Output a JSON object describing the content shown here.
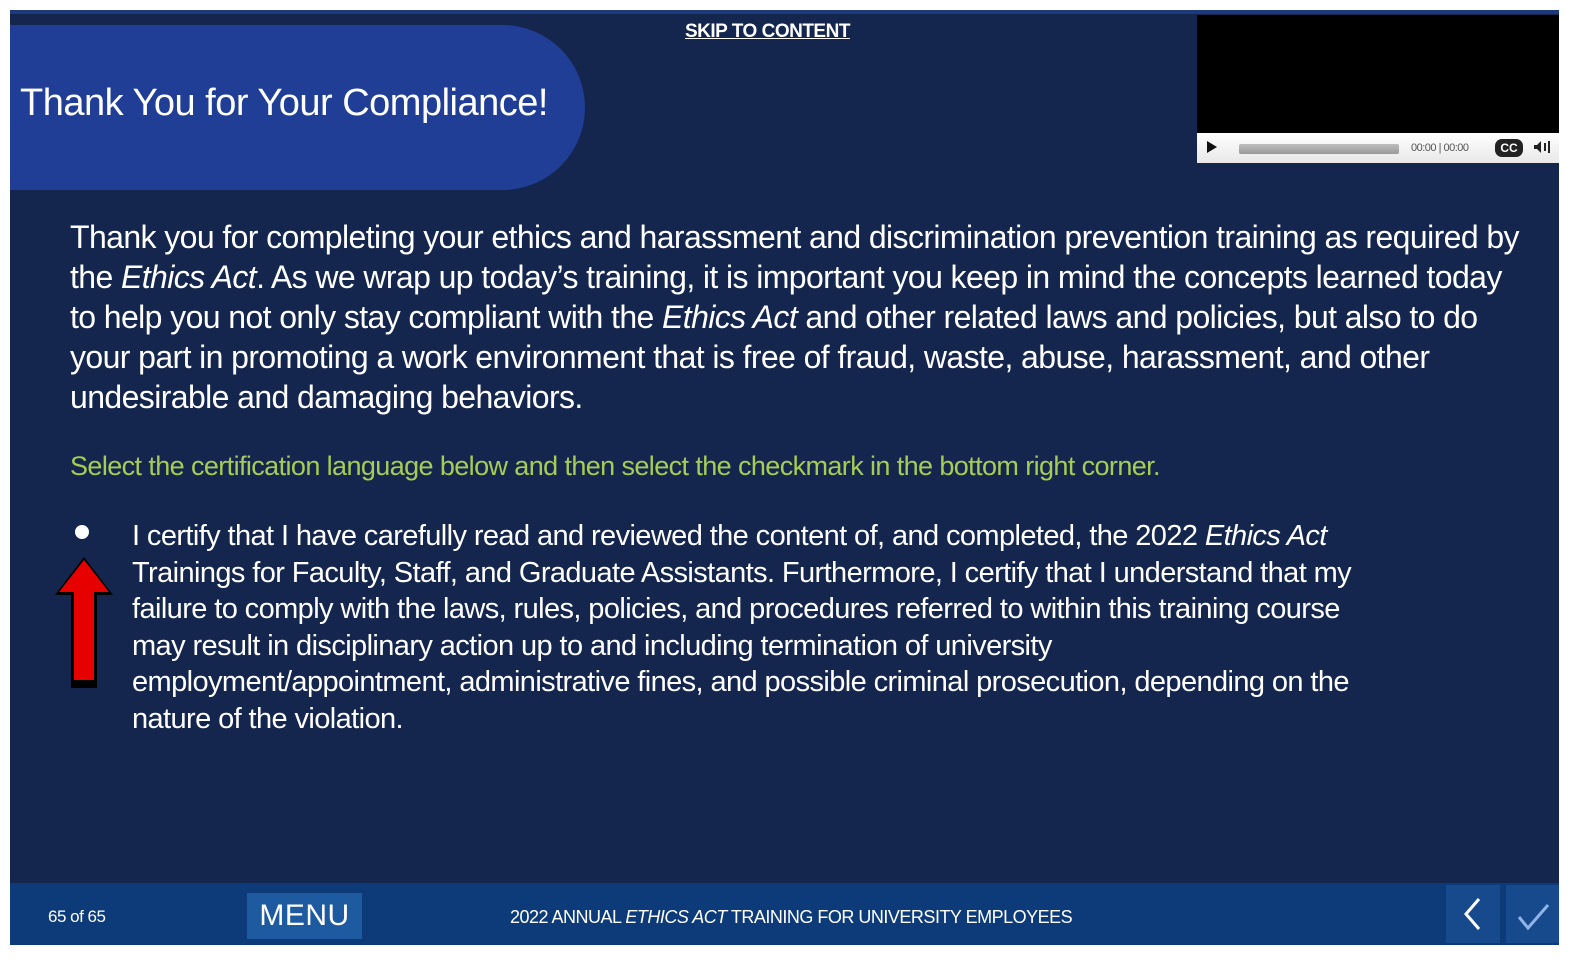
{
  "skip_link": "SKIP TO CONTENT",
  "title": "Thank You for Your Compliance!",
  "video": {
    "time": "00:00 | 00:00",
    "cc_label": "CC"
  },
  "body": {
    "p1_a": "Thank you for completing your ethics and harassment and discrimination prevention training as required by the ",
    "p1_em1": "Ethics Act",
    "p1_b": ". As we wrap up today’s training, it is important you keep in mind the concepts learned today to help you not only stay compliant with the ",
    "p1_em2": "Ethics Act",
    "p1_c": " and other related laws and policies, but also to do your part in promoting a work environment that is free of fraud, waste, abuse, harassment, and other undesirable and damaging behaviors."
  },
  "instruction": "Select the certification language below and then select the checkmark in the bottom right corner.",
  "certification": {
    "a": "I certify that I have carefully read and reviewed the content of, and completed, the 2022 ",
    "em": "Ethics Act",
    "b": " Trainings for Faculty, Staff, and Graduate Assistants. Furthermore, I certify that I understand that my failure to comply with the laws, rules, policies, and procedures referred to within this training course may result in disciplinary action up to and including termination of university employment/appointment, administrative fines, and possible criminal prosecution, depending on the nature of the violation."
  },
  "footer": {
    "page_count": "65 of 65",
    "menu_label": "MENU",
    "course_a": "2022 ANNUAL ",
    "course_em": "ETHICS ACT",
    "course_b": " TRAINING FOR UNIVERSITY EMPLOYEES"
  },
  "colors": {
    "background": "#14264d",
    "title_tab": "#213e96",
    "instruction": "#a5cd55",
    "footer": "#0d3b7a",
    "arrow": "#e60000"
  },
  "icons": [
    "play-icon",
    "cc-icon",
    "volume-icon",
    "red-arrow-icon",
    "chevron-left-icon",
    "checkmark-icon"
  ]
}
